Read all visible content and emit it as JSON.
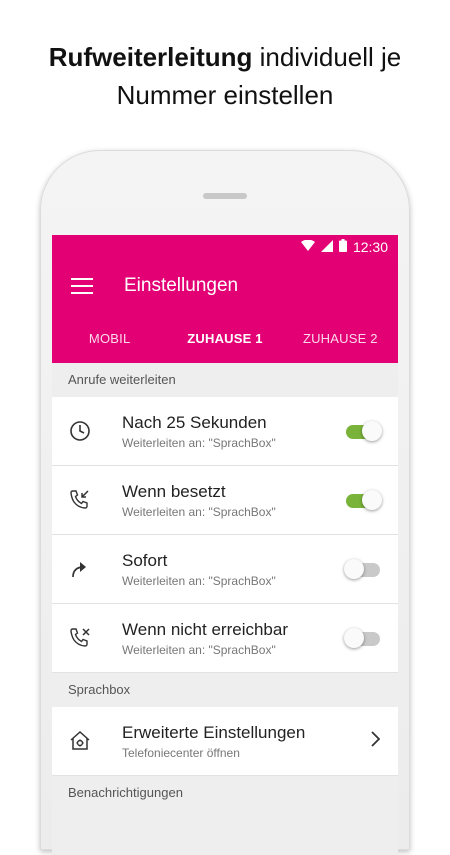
{
  "headline": {
    "bold": "Rufweiterleitung",
    "rest": " individuell je",
    "line2": "Nummer einstellen"
  },
  "status_bar": {
    "time": "12:30"
  },
  "toolbar": {
    "title": "Einstellungen"
  },
  "tabs": [
    {
      "label": "MOBIL",
      "active": false
    },
    {
      "label": "ZUHAUSE 1",
      "active": true
    },
    {
      "label": "ZUHAUSE 2",
      "active": false
    }
  ],
  "sections": [
    {
      "header": "Anrufe weiterleiten",
      "rows": [
        {
          "title": "Nach 25 Sekunden",
          "subtitle": "Weiterleiten an: \"SprachBox\"",
          "icon": "clock-icon",
          "toggle": true
        },
        {
          "title": "Wenn besetzt",
          "subtitle": "Weiterleiten an: \"SprachBox\"",
          "icon": "call-busy-icon",
          "toggle": true
        },
        {
          "title": "Sofort",
          "subtitle": "Weiterleiten an: \"SprachBox\"",
          "icon": "forward-arrow-icon",
          "toggle": false
        },
        {
          "title": "Wenn nicht erreichbar",
          "subtitle": "Weiterleiten an: \"SprachBox\"",
          "icon": "call-unreachable-icon",
          "toggle": false
        }
      ]
    },
    {
      "header": "Sprachbox",
      "rows": [
        {
          "title": "Erweiterte Einstellungen",
          "subtitle": "Telefoniecenter öffnen",
          "icon": "home-settings-icon"
        }
      ]
    }
  ],
  "partial_header": "Benachrichtigungen",
  "colors": {
    "brand": "#e20074",
    "toggle_on": "#7ab33a"
  }
}
